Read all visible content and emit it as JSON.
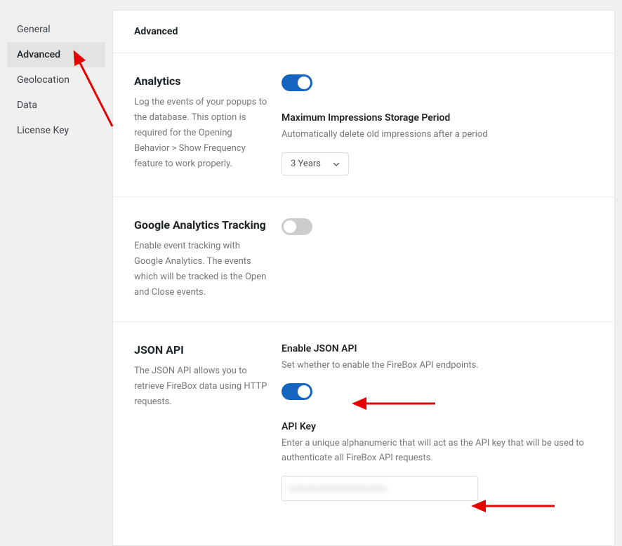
{
  "sidebar": {
    "items": [
      {
        "label": "General"
      },
      {
        "label": "Advanced"
      },
      {
        "label": "Geolocation"
      },
      {
        "label": "Data"
      },
      {
        "label": "License Key"
      }
    ]
  },
  "header": {
    "title": "Advanced"
  },
  "sections": {
    "analytics": {
      "title": "Analytics",
      "desc": "Log the events of your popups to the database. This option is required for the Opening Behavior > Show Frequency feature to work properly.",
      "toggle_on": true,
      "storage_label": "Maximum Impressions Storage Period",
      "storage_desc": "Automatically delete old impressions after a period",
      "storage_value": "3 Years"
    },
    "ga": {
      "title": "Google Analytics Tracking",
      "desc": "Enable event tracking with Google Analytics. The events which will be tracked is the Open and Close events.",
      "toggle_on": false
    },
    "jsonapi": {
      "title": "JSON API",
      "desc": "The JSON API allows you to retrieve FireBox data using HTTP requests.",
      "enable_label": "Enable JSON API",
      "enable_desc": "Set whether to enable the FireBox API endpoints.",
      "toggle_on": true,
      "apikey_label": "API Key",
      "apikey_desc": "Enter a unique alphanumeric that will act as the API key that will be used to authenticate all FireBox API requests.",
      "apikey_value": ""
    }
  }
}
